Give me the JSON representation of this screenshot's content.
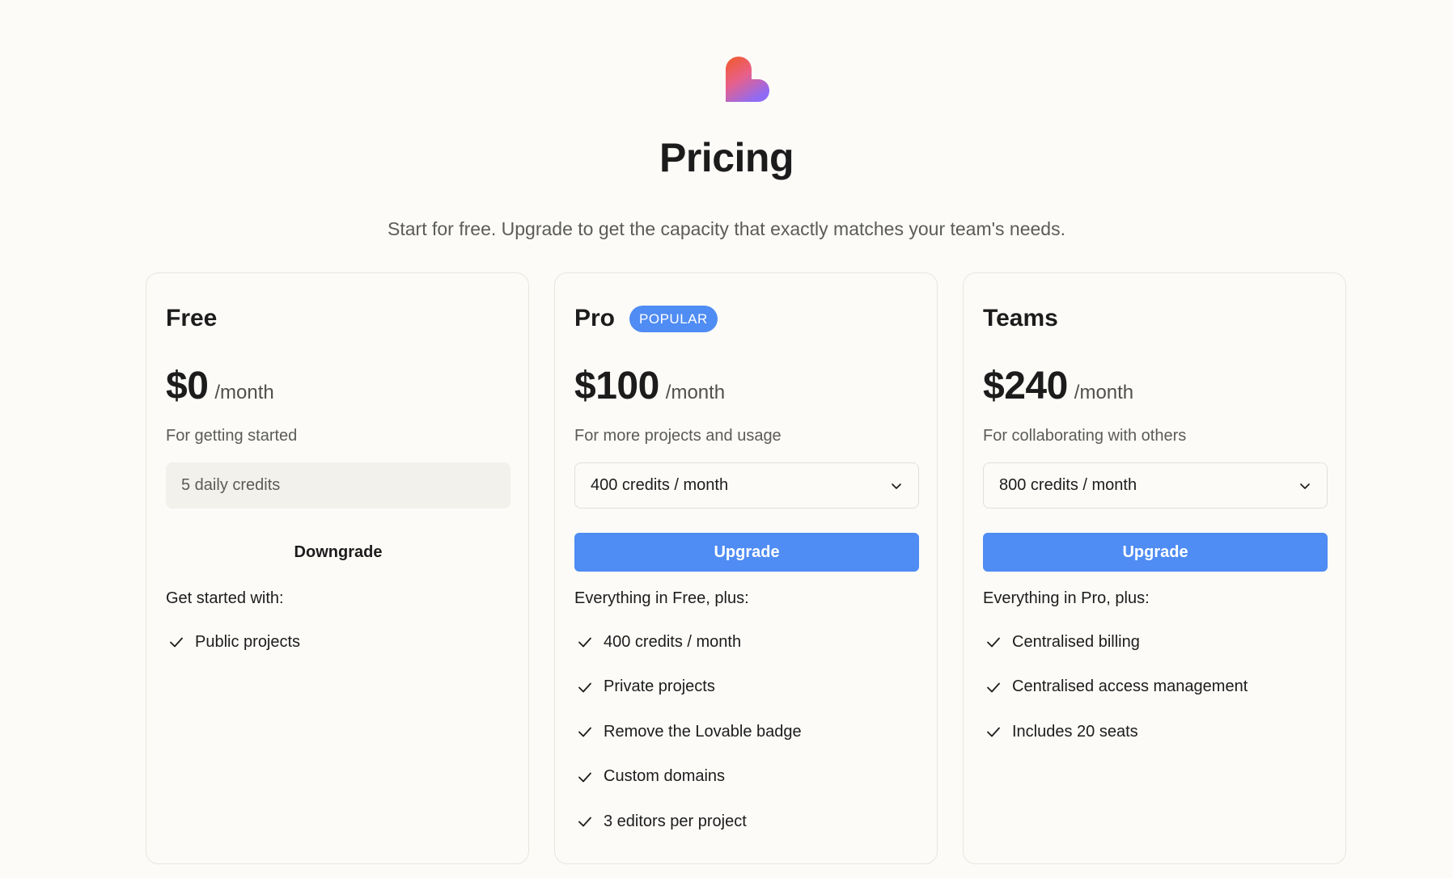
{
  "colors": {
    "accent": "#4f8cf3",
    "background": "#fcfbf8",
    "logo_gradient": [
      "#f15a24",
      "#e8608a",
      "#8f6bf5"
    ]
  },
  "header": {
    "logo_icon": "heart-logo-icon",
    "title": "Pricing",
    "subtitle": "Start for free. Upgrade to get the capacity that exactly matches your team's needs."
  },
  "plans": [
    {
      "name": "Free",
      "price": "$0",
      "period": "/month",
      "description": "For getting started",
      "credits": "5 daily credits",
      "button_label": "Downgrade",
      "includes_heading": "Get started with:",
      "features": [
        "Public projects"
      ]
    },
    {
      "name": "Pro",
      "badge": "POPULAR",
      "price": "$100",
      "period": "/month",
      "description": "For more projects and usage",
      "credits": "400 credits / month",
      "button_label": "Upgrade",
      "includes_heading": "Everything in Free, plus:",
      "features": [
        "400 credits / month",
        "Private projects",
        "Remove the Lovable badge",
        "Custom domains",
        "3 editors per project"
      ]
    },
    {
      "name": "Teams",
      "price": "$240",
      "period": "/month",
      "description": "For collaborating with others",
      "credits": "800 credits / month",
      "button_label": "Upgrade",
      "includes_heading": "Everything in Pro, plus:",
      "features": [
        "Centralised billing",
        "Centralised access management",
        "Includes 20 seats"
      ]
    }
  ]
}
